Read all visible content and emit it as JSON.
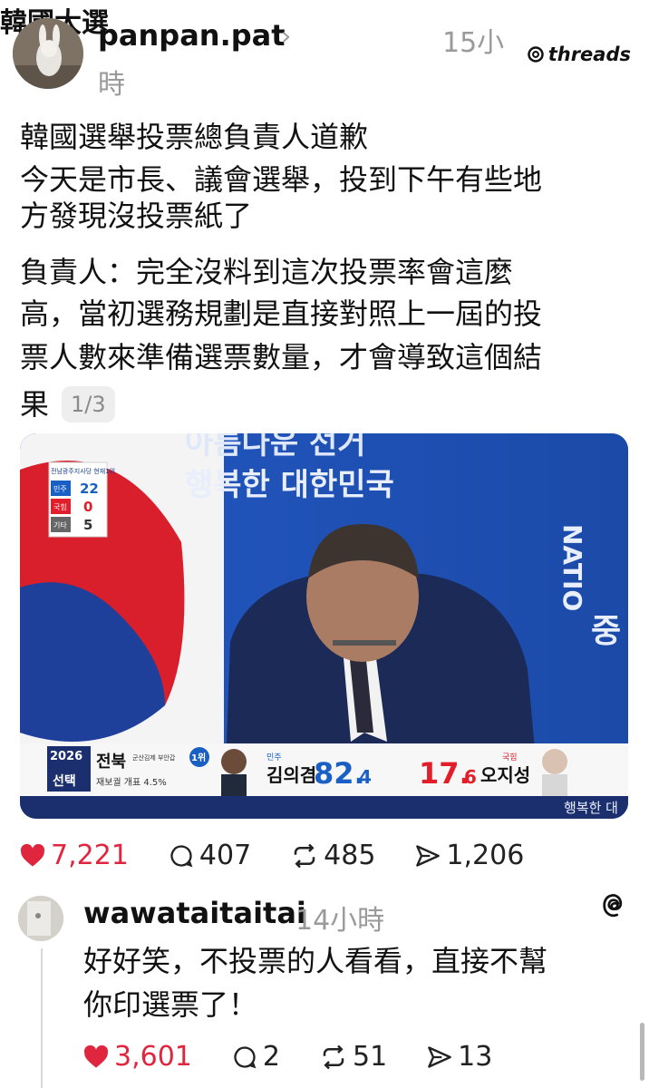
{
  "post": {
    "handle": "panpan.pat",
    "topic": "韓國大選",
    "time_part1": "15小",
    "time_part2": "時",
    "watermark": "threads",
    "text_lines": [
      "韓國選舉投票總負責人道歉",
      "今天是市長、議會選舉，投到下午有些地",
      "方發現沒投票紙了",
      "負責人：完全沒料到這次投票率會這麼",
      "高，當初選務規劃是直接對照上一屆的投",
      "票人數來準備選票數量，才會導致這個結",
      "果"
    ],
    "page_indicator": "1/3",
    "image": {
      "backdrop_line_1": "아름다운 선거",
      "backdrop_line_2": "행복한 대한민국",
      "backdrop_side": "NATIO",
      "backdrop_right": "중",
      "tally": {
        "header": "전남광주지사당 현재1위",
        "rows": [
          {
            "party": "민주",
            "count": "22",
            "color": "#1a5fc4"
          },
          {
            "party": "국힘",
            "count": "0",
            "color": "#e21e2b"
          },
          {
            "party": "기타",
            "count": "5",
            "color": "#666666"
          }
        ]
      },
      "ticker": {
        "year": "2026",
        "label": "선택",
        "region": "전북",
        "sub_region": "군산김제 부안갑",
        "event": "재보궐 개표 4.5%",
        "rank": "1위",
        "cand1_party": "민주",
        "cand1_name": "김의겸",
        "cand1_pct_main": "82.",
        "cand1_pct_dec": "4",
        "cand2_party": "국힘",
        "cand2_pct_main": "17.",
        "cand2_pct_dec": "6",
        "cand2_name": "오지성",
        "right_text": "행복한 대"
      }
    },
    "stats": {
      "likes": "7,221",
      "comments": "407",
      "reposts": "485",
      "shares": "1,206"
    }
  },
  "reply": {
    "handle": "wawataitaitai",
    "time": "14小時",
    "text_lines": [
      "好好笑，不投票的人看看，直接不幫",
      "你印選票了！"
    ],
    "stats": {
      "likes": "3,601",
      "comments": "2",
      "reposts": "51",
      "shares": "13"
    }
  },
  "colors": {
    "like_red": "#e0263f",
    "muted": "#9a9a9a",
    "primary_text": "#111111"
  }
}
